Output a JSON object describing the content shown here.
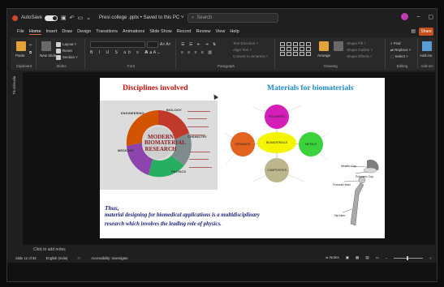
{
  "titlebar": {
    "autosave_label": "AutoSave",
    "autosave_state": "Off",
    "doc_title": "Presi college .pptx • Saved to this PC ˅",
    "search_placeholder": "Search"
  },
  "tabs": [
    "File",
    "Home",
    "Insert",
    "Draw",
    "Design",
    "Transitions",
    "Animations",
    "Slide Show",
    "Record",
    "Review",
    "View",
    "Help"
  ],
  "active_tab": "Home",
  "share_label": "Share",
  "ribbon": {
    "groups": [
      "Clipboard",
      "Slides",
      "Font",
      "Paragraph",
      "Drawing",
      "Editing",
      "Add-ins"
    ],
    "clipboard_paste": "Paste",
    "slides_new": "New Slide",
    "slides_layout": "Layout ˅",
    "slides_reset": "Reset",
    "slides_section": "Section ˅",
    "para_text_dir": "Text Direction ˅",
    "para_align": "Align Text ˅",
    "para_smartart": "Convert to SmartArt ˅",
    "drawing_arrange": "Arrange",
    "drawing_quick": "Quick Styles ˅",
    "drawing_fill": "Shape Fill ˅",
    "drawing_outline": "Shape Outline ˅",
    "drawing_effects": "Shape Effects ˅",
    "editing_find": "Find",
    "editing_replace": "Replace ˅",
    "editing_select": "Select ˅",
    "addins": "Add-ins"
  },
  "rail_label": "Thumbnails",
  "slide": {
    "title_left": "Disciplines involved",
    "title_right": "Materials for biomaterials",
    "venn_center": "MODERN\nBIOMATERIAL\nRESEARCH",
    "venn_labels": [
      "ENGINEERING",
      "BIOLOGY",
      "CHEMISTRY",
      "PHYSICS",
      "MEDICINE"
    ],
    "materials_center": "BIOMATERIALS",
    "materials_bubbles": [
      "POLYMERS",
      "METALS",
      "CERAMICS",
      "COMPOSITES"
    ],
    "implant_labels": [
      "Metallic Cup",
      "Polymeric Cup",
      "Femoral Head",
      "Hip stem"
    ],
    "caption_thus": "Thus,",
    "caption_line1": "material designing for  biomedical applications  is a multidisciplinary",
    "caption_line2": "research  which involves  the leading role  of physics."
  },
  "notes_placeholder": "Click to add notes",
  "status": {
    "slide_info": "Slide 12 of 92",
    "language": "English (India)",
    "accessibility": "Accessibility: Investigate",
    "notes_btn": "Notes"
  }
}
